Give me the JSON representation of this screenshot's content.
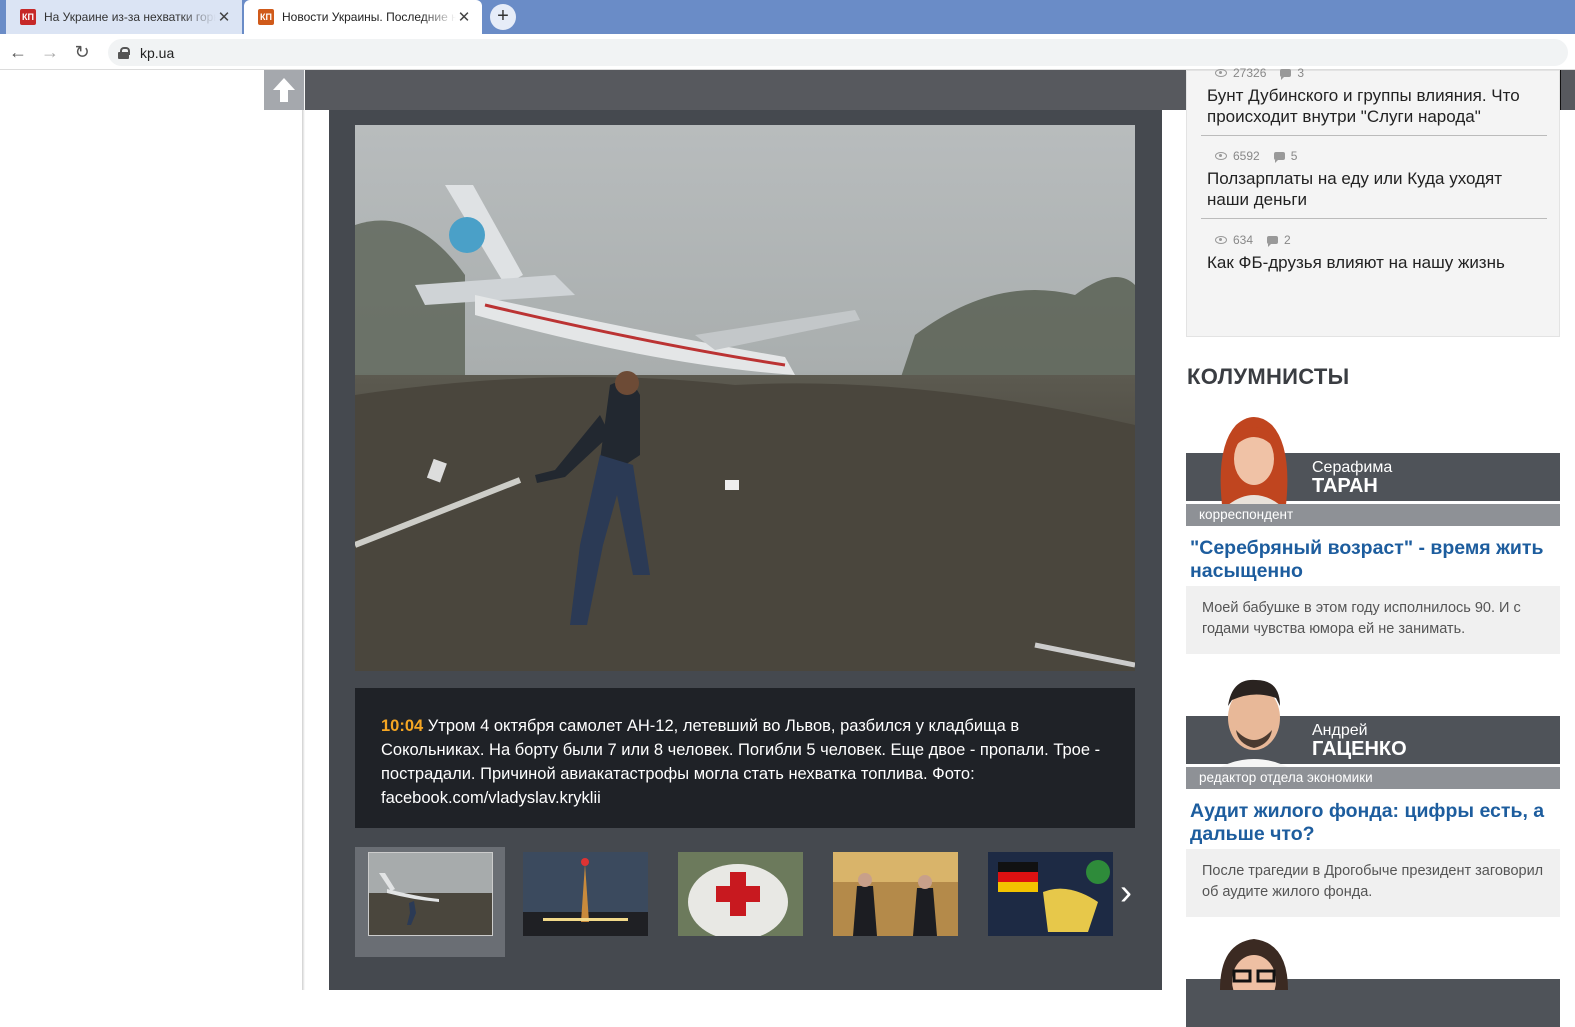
{
  "browser": {
    "tabs": [
      {
        "title": "На Украине из-за нехватки горючего",
        "active": false
      },
      {
        "title": "Новости Украины. Последние новости",
        "active": true
      }
    ],
    "url": "kp.ua"
  },
  "gallery": {
    "caption_time": "10:04",
    "caption_text": " Утром 4 октября самолет АН-12, летевший во Львов, разбился у кладбища в Сокольниках. На борту были 7 или 8 человек. Погибли 5 человек. Еще двое - пропали. Трое - пострадали. Причиной авиакатастрофы могла стать нехватка топлива. Фото: facebook.com/vladyslav.kryklii",
    "thumbs": [
      "plane-crash",
      "night-tower",
      "red-cross-helmet",
      "meeting-room",
      "protest-flags"
    ]
  },
  "sidebar": {
    "popular": [
      {
        "views": "27326",
        "comments": "3",
        "title": "Бунт Дубинского и группы влияния. Что происходит внутри \"Слуги народа\""
      },
      {
        "views": "6592",
        "comments": "5",
        "title": "Ползарплаты на еду или Куда уходят наши деньги"
      },
      {
        "views": "634",
        "comments": "2",
        "title": "Как ФБ-друзья влияют на нашу жизнь"
      }
    ],
    "columnists_heading": "КОЛУМНИСТЫ",
    "columnists": [
      {
        "first": "Серафима",
        "last": "ТАРАН",
        "role": "корреспондент",
        "title": "\"Серебряный возраст\" - время жить насыщенно",
        "lead": "Моей бабушке в этом году исполнилось 90. И с годами чувства юмора ей не занимать."
      },
      {
        "first": "Андрей",
        "last": "ГАЦЕНКО",
        "role": "редактор отдела экономики",
        "title": "Аудит жилого фонда: цифры есть, а дальше что?",
        "lead": "После трагедии в Дрогобыче президент заговорил об аудите жилого фонда."
      }
    ]
  },
  "colors": {
    "accent_time": "#f5a623",
    "link_blue": "#1d5d9e",
    "bar_dark": "#57595e",
    "gallery_bg": "#45494f"
  }
}
